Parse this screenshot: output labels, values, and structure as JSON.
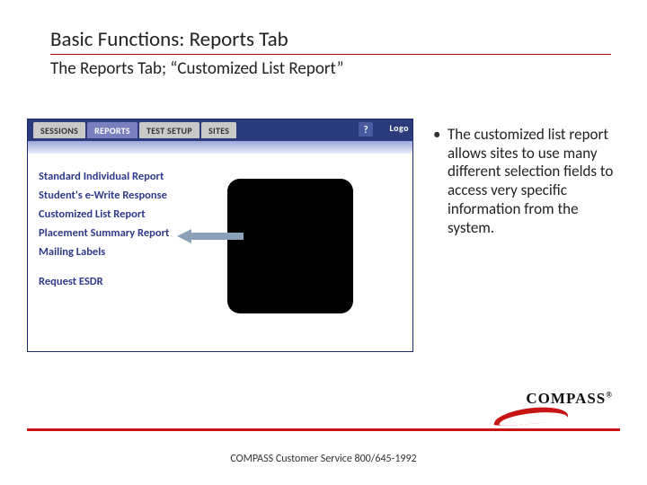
{
  "header": {
    "title": "Basic Functions: Reports Tab",
    "subtitle": "The Reports Tab; “Customized List Report”"
  },
  "screenshot": {
    "tabs": [
      {
        "label": "SESSIONS"
      },
      {
        "label": "REPORTS"
      },
      {
        "label": "TEST SETUP"
      },
      {
        "label": "SITES"
      }
    ],
    "help_label": "?",
    "logout_label": "Logo",
    "menu": [
      "Standard Individual Report",
      "Student's e-Write Response",
      "Customized List Report",
      "Placement Summary Report",
      "Mailing Labels",
      "Request ESDR"
    ]
  },
  "bullets": [
    "The customized list report allows sites to use many different selection fields to access very specific information from the system."
  ],
  "logo": {
    "text": "COMPASS",
    "reg": "®"
  },
  "footer": "COMPASS Customer Service 800/645-1992"
}
